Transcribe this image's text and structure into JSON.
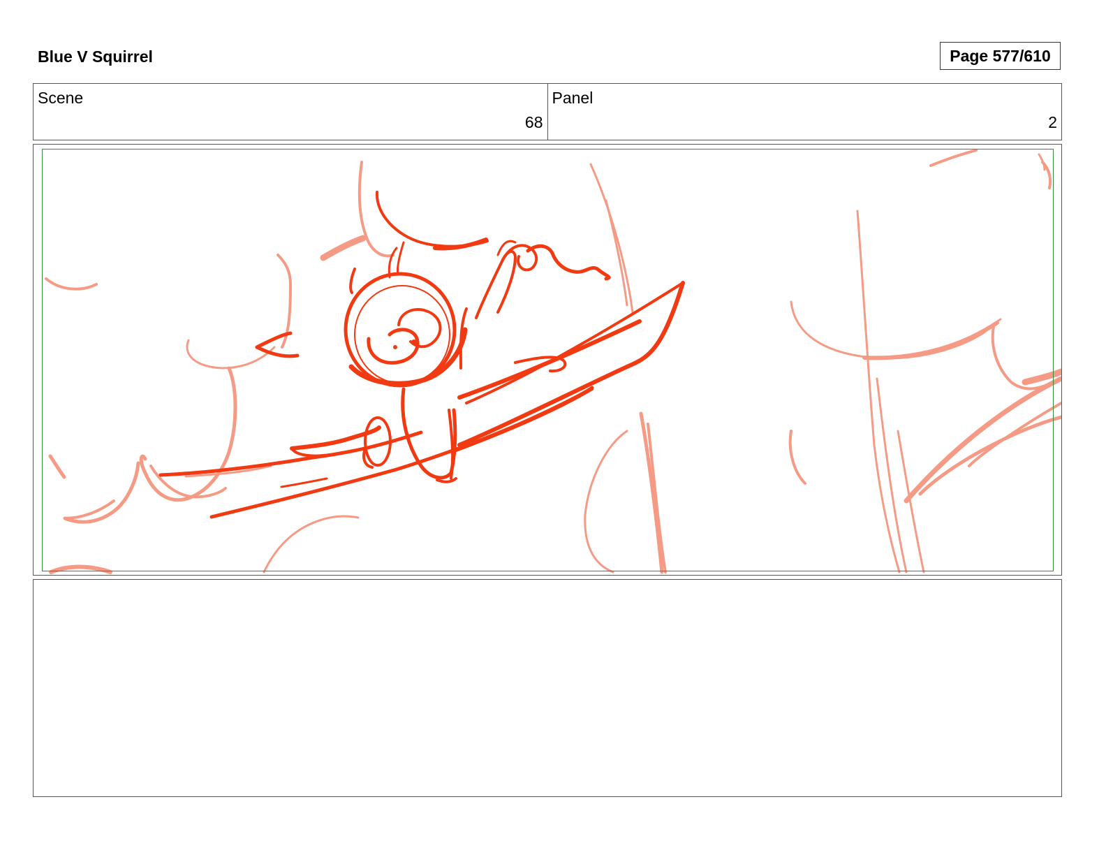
{
  "header": {
    "project_title": "Blue V Squirrel",
    "page_label": "Page 577/610"
  },
  "info": {
    "scene_label": "Scene",
    "scene_value": "68",
    "panel_label": "Panel",
    "panel_value": "2"
  },
  "panel": {
    "sketch_subject": "squirrel-on-branch-rough-sketch",
    "colors": {
      "foreground_line": "#f23a12",
      "background_line": "#f59b85",
      "safe_frame": "#3b8a3b"
    }
  },
  "notes": {
    "text": ""
  }
}
